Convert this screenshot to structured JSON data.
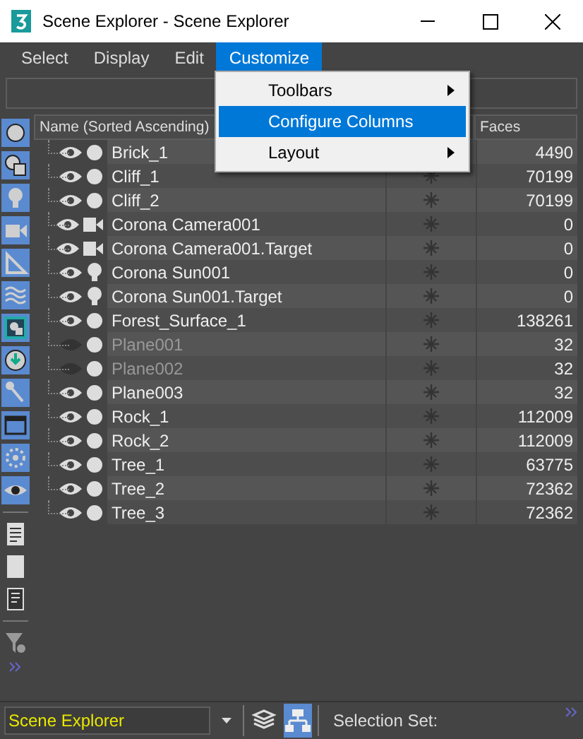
{
  "window": {
    "title": "Scene Explorer - Scene Explorer"
  },
  "menu": [
    {
      "label": "Select",
      "selected": false
    },
    {
      "label": "Display",
      "selected": false
    },
    {
      "label": "Edit",
      "selected": false
    },
    {
      "label": "Customize",
      "selected": true
    }
  ],
  "dropdown": [
    {
      "label": "Toolbars",
      "submenu": true,
      "selected": false
    },
    {
      "label": "Configure Columns",
      "submenu": false,
      "selected": true
    },
    {
      "label": "Layout",
      "submenu": true,
      "selected": false
    }
  ],
  "table": {
    "columns": [
      "Name (Sorted Ascending)",
      "Faces"
    ],
    "rows": [
      {
        "name": "Brick_1",
        "kind": "object",
        "visible": true,
        "faces": "4490"
      },
      {
        "name": "Cliff_1",
        "kind": "object",
        "visible": true,
        "faces": "70199"
      },
      {
        "name": "Cliff_2",
        "kind": "object",
        "visible": true,
        "faces": "70199"
      },
      {
        "name": "Corona Camera001",
        "kind": "camera",
        "visible": true,
        "faces": "0"
      },
      {
        "name": "Corona Camera001.Target",
        "kind": "camera",
        "visible": true,
        "faces": "0"
      },
      {
        "name": "Corona Sun001",
        "kind": "light",
        "visible": true,
        "faces": "0"
      },
      {
        "name": "Corona Sun001.Target",
        "kind": "light",
        "visible": true,
        "faces": "0"
      },
      {
        "name": "Forest_Surface_1",
        "kind": "object",
        "visible": true,
        "faces": "138261"
      },
      {
        "name": "Plane001",
        "kind": "object",
        "visible": false,
        "faces": "32"
      },
      {
        "name": "Plane002",
        "kind": "object",
        "visible": false,
        "faces": "32"
      },
      {
        "name": "Plane003",
        "kind": "object",
        "visible": true,
        "faces": "32"
      },
      {
        "name": "Rock_1",
        "kind": "object",
        "visible": true,
        "faces": "112009"
      },
      {
        "name": "Rock_2",
        "kind": "object",
        "visible": true,
        "faces": "112009"
      },
      {
        "name": "Tree_1",
        "kind": "object",
        "visible": true,
        "faces": "63775"
      },
      {
        "name": "Tree_2",
        "kind": "object",
        "visible": true,
        "faces": "72362"
      },
      {
        "name": "Tree_3",
        "kind": "object",
        "visible": true,
        "faces": "72362"
      }
    ]
  },
  "status_bar": {
    "explorer": "Scene Explorer",
    "views": [
      {
        "kind": "layers",
        "selected": false
      },
      {
        "kind": "hierarchy",
        "selected": true
      }
    ],
    "selection_set_label": "Selection Set:"
  }
}
